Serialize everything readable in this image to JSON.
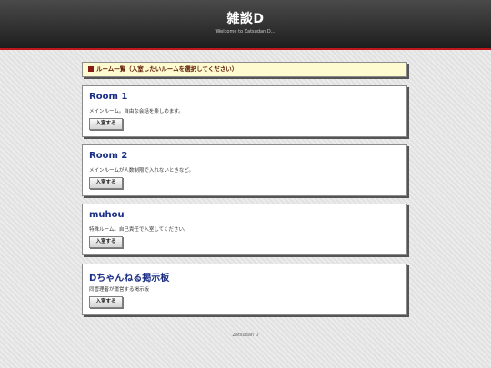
{
  "header": {
    "title": "雑談D",
    "subtitle": "Welcome to Zatsudan D..."
  },
  "notice": {
    "text": "ルーム一覧（入室したいルームを選択してください）"
  },
  "rooms": [
    {
      "title": "Room 1",
      "description": "メインルーム。自由な会話を楽しめます。",
      "button": "入室する"
    },
    {
      "title": "Room 2",
      "description": "メインルームが人数制限で入れないときなど。",
      "button": "入室する"
    },
    {
      "title": "muhou",
      "description": "特殊ルーム。自己責任で入室してください。",
      "button": "入室する"
    },
    {
      "title": "Dちゃんねる掲示板",
      "description": "同管理者が運営する掲示板",
      "button": "入室する"
    }
  ],
  "footer": {
    "text": "Zatsudan D"
  },
  "colors": {
    "header_accent": "#c0171c",
    "room_title": "#1b2e86",
    "notice_background": "#fffbd1"
  }
}
